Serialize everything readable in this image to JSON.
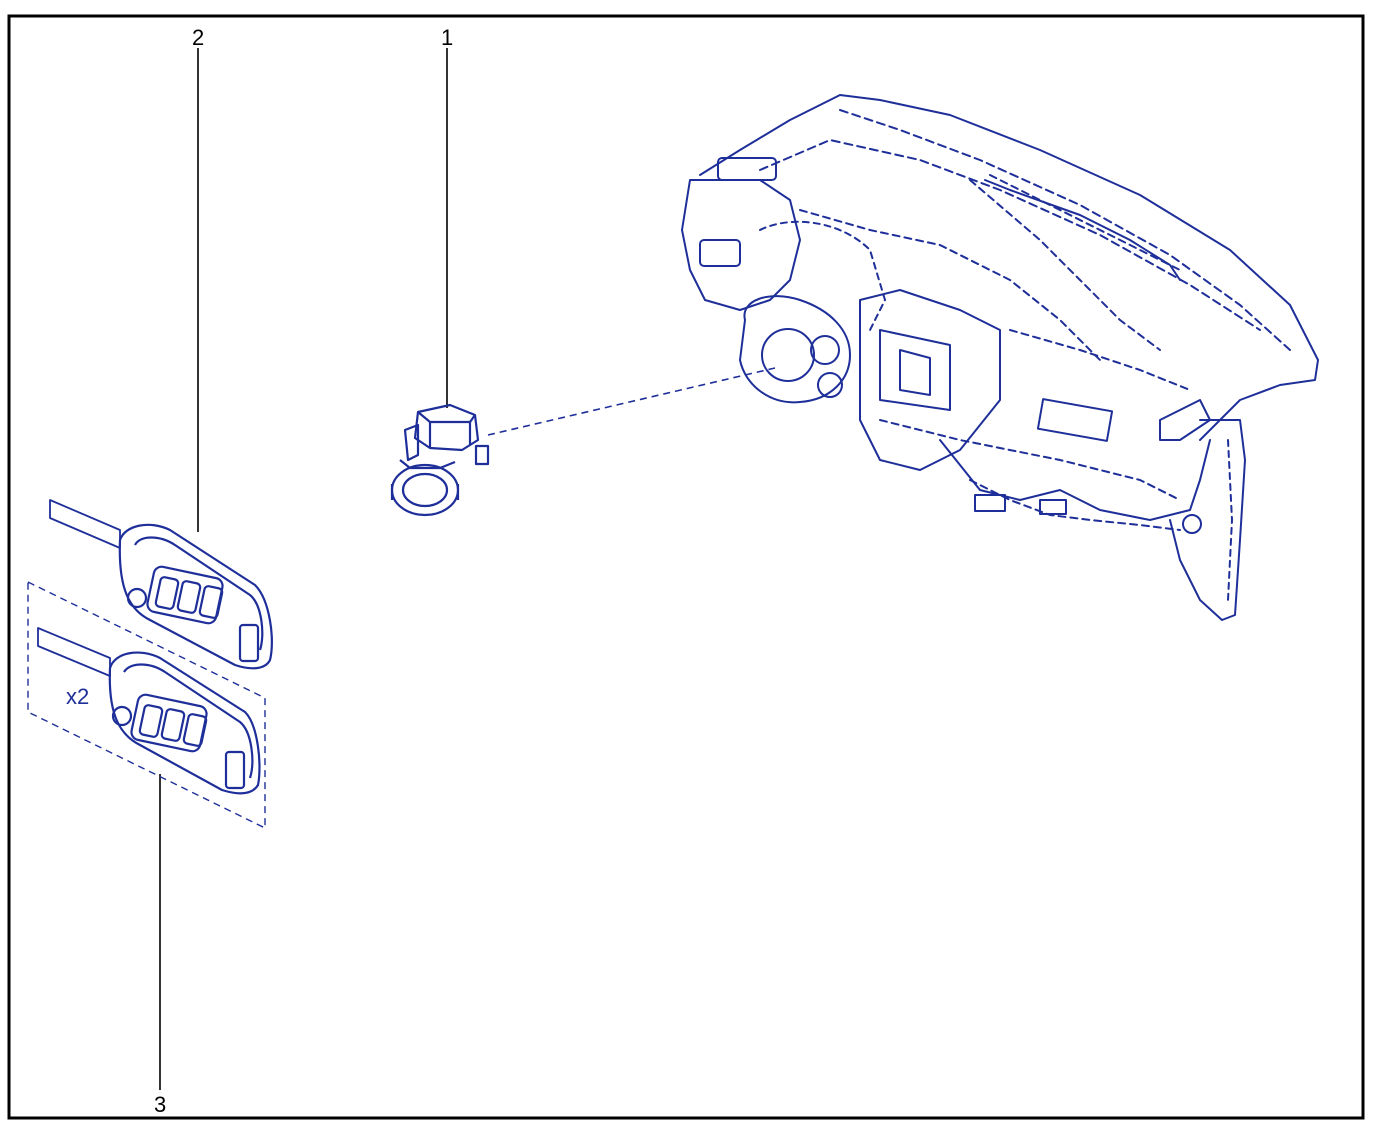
{
  "colors": {
    "line_art": "#1f2f9a",
    "leader": "#000000",
    "frame": "#000000",
    "background": "#ffffff"
  },
  "callouts": [
    {
      "id": "1",
      "label": "1"
    },
    {
      "id": "2",
      "label": "2"
    },
    {
      "id": "3",
      "label": "3"
    }
  ],
  "quantity_note": "x2"
}
